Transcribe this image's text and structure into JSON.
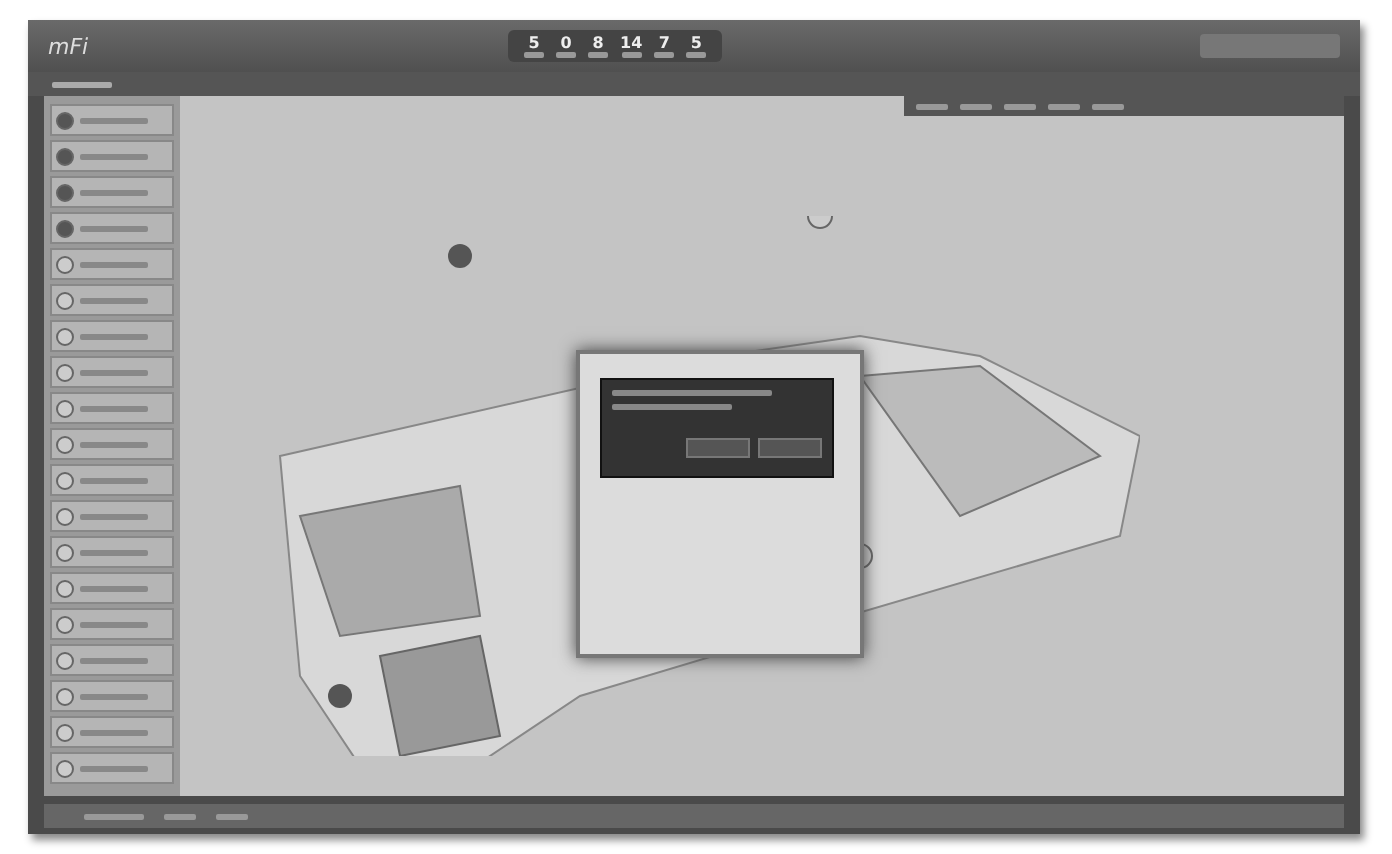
{
  "header": {
    "logo": "mFi"
  },
  "stats": [
    {
      "value": "5"
    },
    {
      "value": "0"
    },
    {
      "value": "8"
    },
    {
      "value": "14"
    },
    {
      "value": "7"
    },
    {
      "value": "5"
    }
  ],
  "sidebar": {
    "items": [
      {
        "kind": "filled"
      },
      {
        "kind": "filled"
      },
      {
        "kind": "filled"
      },
      {
        "kind": "filled"
      },
      {
        "kind": "outline"
      },
      {
        "kind": "outline"
      },
      {
        "kind": "outline"
      },
      {
        "kind": "outline"
      },
      {
        "kind": "outline"
      },
      {
        "kind": "outline"
      },
      {
        "kind": "outline"
      },
      {
        "kind": "outline"
      },
      {
        "kind": "outline"
      },
      {
        "kind": "outline"
      },
      {
        "kind": "outline"
      },
      {
        "kind": "outline"
      },
      {
        "kind": "outline"
      },
      {
        "kind": "outline"
      },
      {
        "kind": "outline"
      }
    ]
  }
}
